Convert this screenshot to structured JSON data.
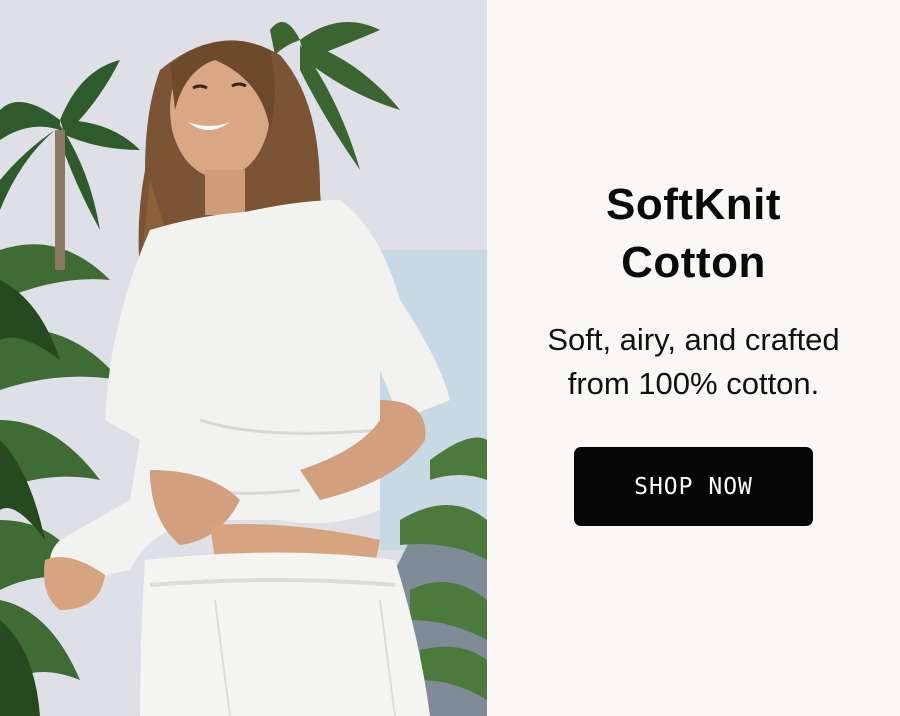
{
  "banner": {
    "headline_line1": "SoftKnit",
    "headline_line2": "Cotton",
    "subtext_line1": "Soft, airy, and crafted",
    "subtext_line2": "from 100% cotton.",
    "cta_label": "SHOP NOW"
  },
  "colors": {
    "background": "#faf8f5",
    "button": "#050505",
    "button_text": "#ffffff",
    "text": "#0a0a0a"
  }
}
